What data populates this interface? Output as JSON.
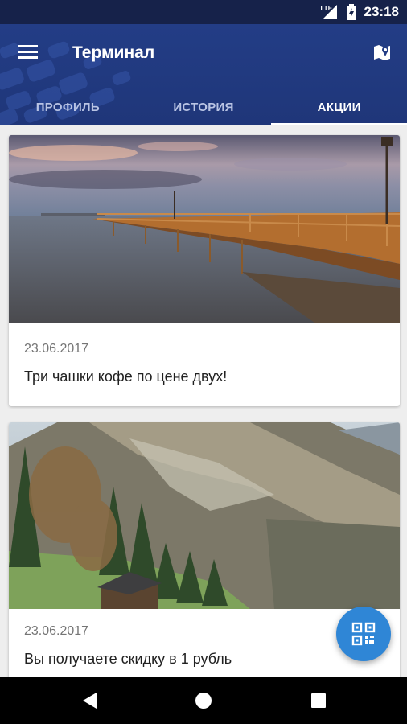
{
  "status_bar": {
    "network": "LTE",
    "time": "23:18"
  },
  "app_bar": {
    "title": "Терминал",
    "menu_icon": "hamburger-menu-icon",
    "map_icon": "map-marker-icon",
    "color": "#233d86"
  },
  "tabs": [
    {
      "label": "ПРОФИЛЬ",
      "active": false
    },
    {
      "label": "ИСТОРИЯ",
      "active": false
    },
    {
      "label": "АКЦИИ",
      "active": true
    }
  ],
  "promotions": [
    {
      "image": "pier-at-sunset-photo",
      "date": "23.06.2017",
      "text": "Три чашки кофе по цене двух!"
    },
    {
      "image": "mountain-valley-cabin-photo",
      "date": "23.06.2017",
      "text": "Вы получаете скидку в 1 рубль"
    }
  ],
  "fab": {
    "icon": "qr-code-icon",
    "color": "#2f86d6"
  },
  "nav_bar": {
    "back": "back-icon",
    "home": "home-icon",
    "recents": "recents-icon"
  }
}
